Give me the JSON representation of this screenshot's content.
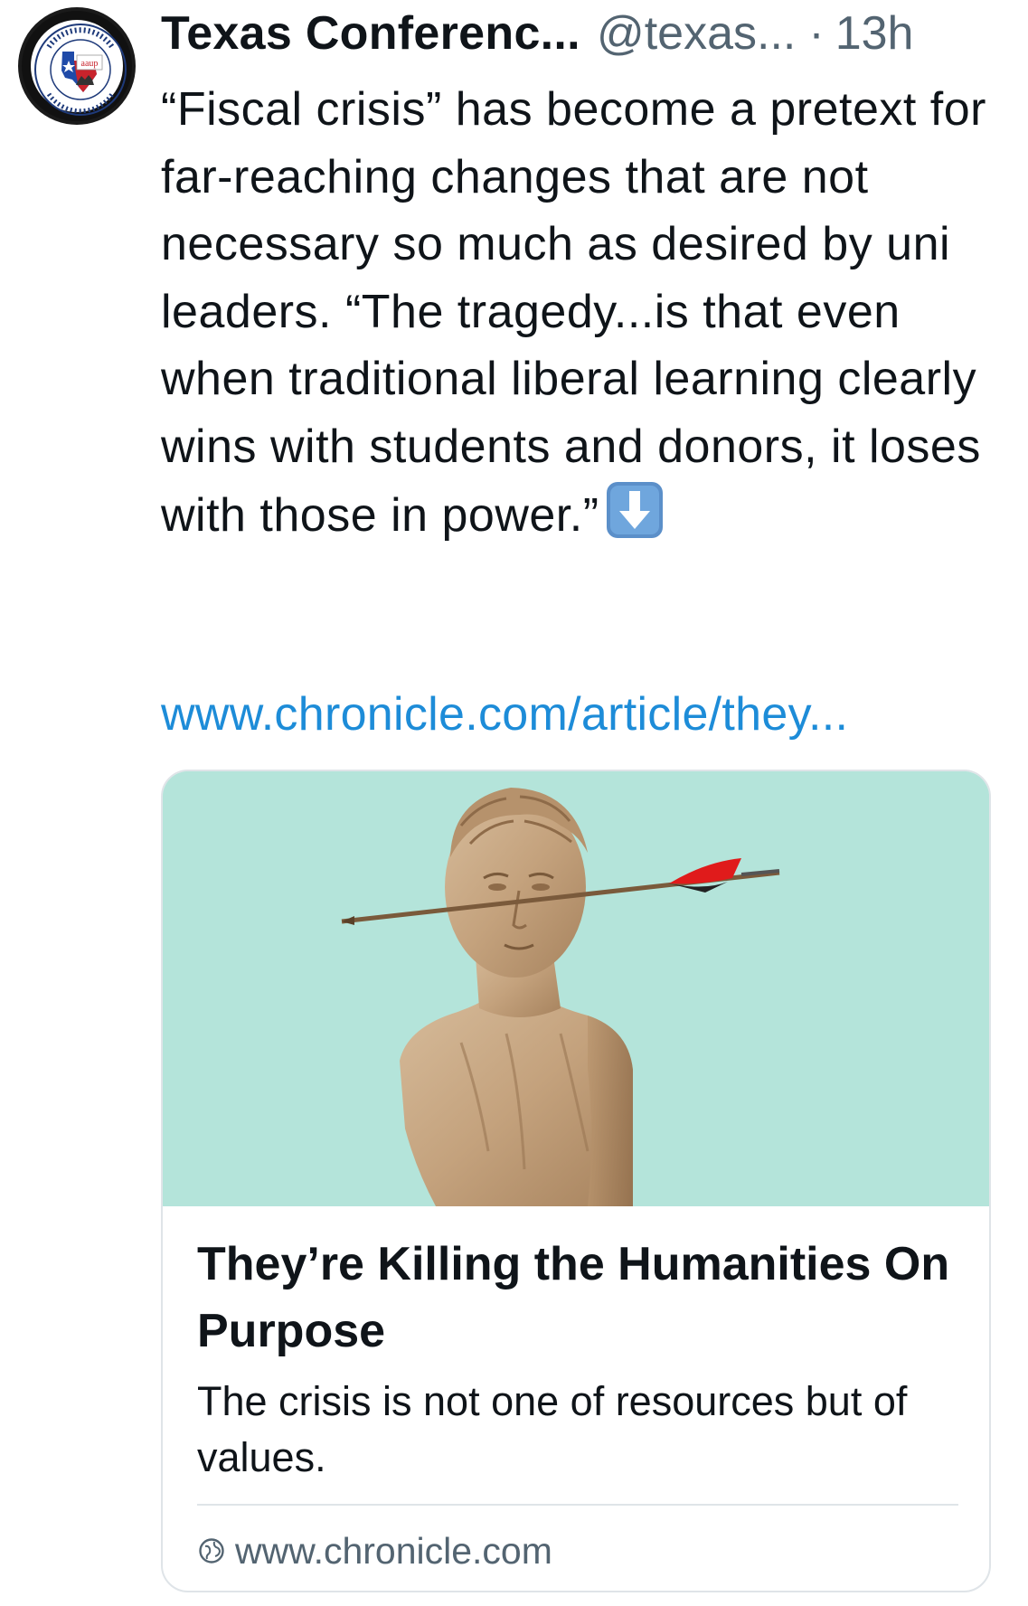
{
  "post": {
    "display_name": "Texas Conferenc...",
    "handle": "@texas...",
    "separator": "·",
    "time": "13h",
    "avatar_text": "aaup",
    "text": "“Fiscal crisis” has become a pretext for far-reaching changes that are not necessary so much as desired by uni leaders. “The tragedy...is that even when traditional liberal learning clearly wins with students and donors, it loses with those in power.”",
    "emoji_icon": "down-arrow-emoji",
    "link_text": "www.chronicle.com/article/they..."
  },
  "card": {
    "image_description_icon": "statue-arrow-image",
    "title": "They’re Killing the Humanities On Purpose",
    "description": "The crisis is not one of resources but of values.",
    "domain": "www.chronicle.com",
    "domain_icon": "globe-icon"
  },
  "colors": {
    "link": "#1d8cd8",
    "secondary_text": "#536471",
    "card_border": "#dfe4e8",
    "image_background": "#b4e4da"
  }
}
